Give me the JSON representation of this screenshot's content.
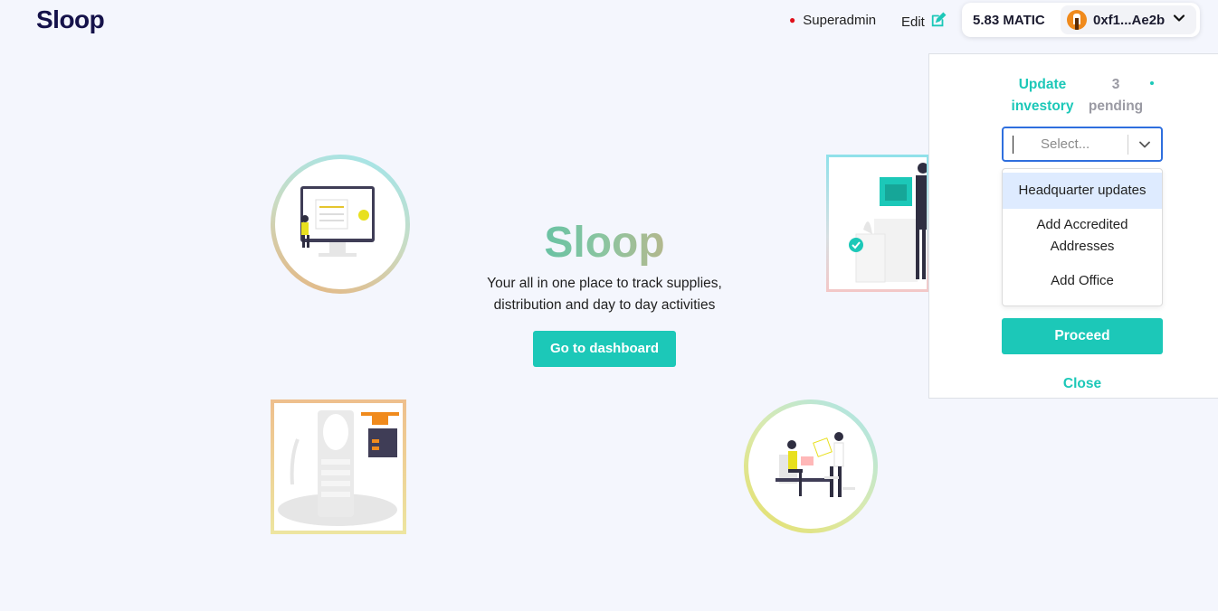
{
  "app": {
    "logo": "Sloop"
  },
  "header": {
    "role": "Superadmin",
    "edit_label": "Edit",
    "balance": "5.83 MATIC",
    "account": "0xf1...Ae2b",
    "status_dot_color": "#e0101b"
  },
  "hero": {
    "title": "Sloop",
    "subtitle_line1": "Your all in one place to track supplies,",
    "subtitle_line2": "distribution and day to day activities",
    "cta_label": "Go to dashboard"
  },
  "panel": {
    "tab_active": "Update investory",
    "tab_count": "3 pending",
    "select_placeholder": "Select...",
    "options": [
      "Headquarter updates",
      "Add Accredited Addresses",
      "Add Office"
    ],
    "proceed_label": "Proceed",
    "close_label": "Close"
  },
  "colors": {
    "accent": "#1cc8b8",
    "brand_dark": "#15124a",
    "background": "#f4f6fd",
    "focus_border": "#2f6fde",
    "highlight_option": "#deebff"
  },
  "icons": {
    "edit": "edit-icon",
    "avatar": "metamask-fox-icon",
    "wallet_chevron": "chevron-down-icon",
    "select_chevron": "chevron-down-icon"
  }
}
